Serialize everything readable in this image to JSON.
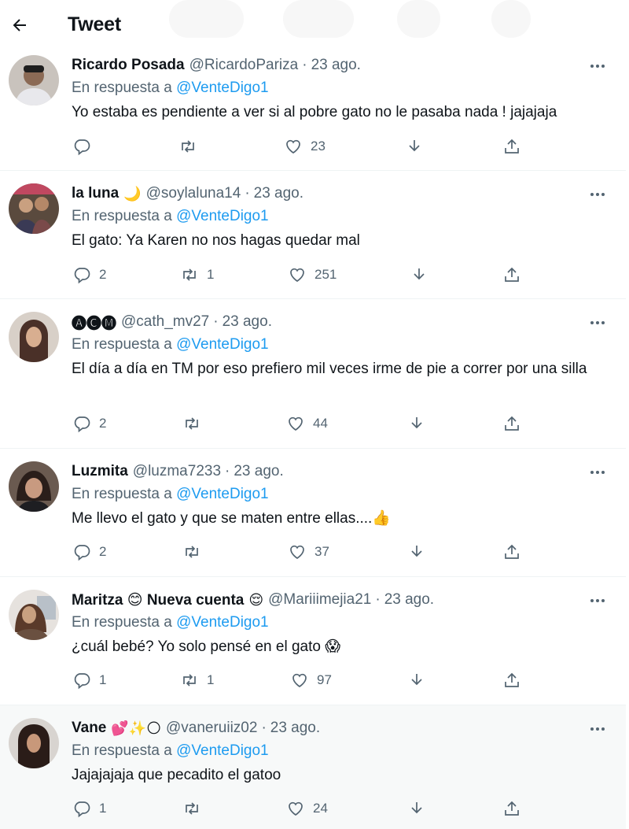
{
  "header": {
    "title": "Tweet"
  },
  "replying_prefix": "En respuesta a",
  "tweets": [
    {
      "name": "Ricardo Posada",
      "name_emoji": "",
      "handle": "@RicardoPariza",
      "sep": "·",
      "time": "23 ago.",
      "mention": "@VenteDigo1",
      "text": "Yo estaba es pendiente a ver si al pobre gato no le pasaba nada ! jajajaja",
      "replies": "",
      "retweets": "",
      "likes": "23",
      "avatar_color": "#b7b0a8"
    },
    {
      "name": "la luna",
      "name_emoji": "🌙",
      "handle": "@soylaluna14",
      "sep": "·",
      "time": "23 ago.",
      "mention": "@VenteDigo1",
      "text": "El gato: Ya Karen no nos hagas quedar mal",
      "replies": "2",
      "retweets": "1",
      "likes": "251",
      "avatar_color": "#6b5a4a"
    },
    {
      "name": "🅐🅒🅜",
      "name_emoji": "",
      "handle": "@cath_mv27",
      "sep": "·",
      "time": "23 ago.",
      "mention": "@VenteDigo1",
      "text": "El día a día en TM por eso prefiero mil veces irme de pie a correr por una silla",
      "replies": "2",
      "retweets": "",
      "likes": "44",
      "avatar_color": "#8a6a55"
    },
    {
      "name": "Luzmita",
      "name_emoji": "",
      "handle": "@luzma7233",
      "sep": "·",
      "time": "23 ago.",
      "mention": "@VenteDigo1",
      "text": "Me llevo el gato y que se maten entre ellas....👍",
      "replies": "2",
      "retweets": "",
      "likes": "37",
      "avatar_color": "#4a3a33"
    },
    {
      "name": "Maritza 😊 Nueva cuenta",
      "name_emoji": "😌",
      "handle": "@Mariiimejia21",
      "sep": "·",
      "time": "23 ago.",
      "mention": "@VenteDigo1",
      "text": "¿cuál bebé? Yo solo pensé en el gato 😱",
      "replies": "1",
      "retweets": "1",
      "likes": "97",
      "avatar_color": "#9a8a7a"
    },
    {
      "name": "Vane",
      "name_emoji": "💕✨🌕",
      "handle": "@vaneruiiz02",
      "sep": "·",
      "time": "23 ago.",
      "mention": "@VenteDigo1",
      "text": "Jajajajaja que pecadito el gatoo",
      "replies": "1",
      "retweets": "",
      "likes": "24",
      "avatar_color": "#7a6050"
    }
  ],
  "colors": {
    "accent": "#1d9bf0",
    "muted": "#536471",
    "text": "#0f1419",
    "highlight_bg": "#f7f9f9"
  }
}
